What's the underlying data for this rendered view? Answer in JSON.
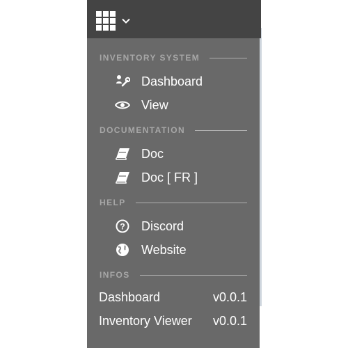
{
  "sections": [
    {
      "title": "INVENTORY SYSTEM",
      "items": [
        {
          "label": "Dashboard",
          "icon": "tools-icon"
        },
        {
          "label": "View",
          "icon": "eye-icon"
        }
      ]
    },
    {
      "title": "DOCUMENTATION",
      "items": [
        {
          "label": "Doc",
          "icon": "book-icon"
        },
        {
          "label": "Doc [ FR ]",
          "icon": "book-icon"
        }
      ]
    },
    {
      "title": "HELP",
      "items": [
        {
          "label": "Discord",
          "icon": "question-circle-icon"
        },
        {
          "label": "Website",
          "icon": "globe-icon"
        }
      ]
    },
    {
      "title": "INFOS",
      "rows": [
        {
          "name": "Dashboard",
          "version": "v0.0.1"
        },
        {
          "name": "Inventory Viewer",
          "version": "v0.0.1"
        }
      ]
    }
  ],
  "colors": {
    "topbar": "#444444",
    "panel": "#696969",
    "section_text": "#a7a7a7",
    "item_text": "#ffffff"
  }
}
